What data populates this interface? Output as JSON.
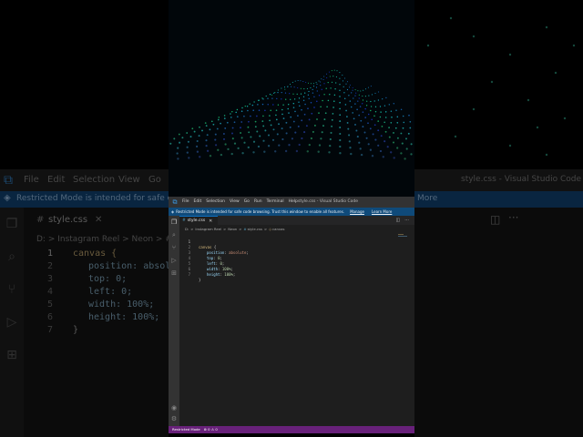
{
  "window": {
    "title": "style.css - Visual Studio Code",
    "menu": [
      "File",
      "Edit",
      "Selection",
      "View",
      "Go",
      "Run",
      "Terminal",
      "Help"
    ]
  },
  "banner": {
    "message": "Restricted Mode is intended for safe code browsing. Trust this window to enable all features.",
    "manage_link": "Manage",
    "learn_more_link": "Learn More"
  },
  "tab": {
    "icon": "#",
    "filename": "style.css",
    "close": "✕"
  },
  "breadcrumb": {
    "items": [
      "D:",
      "Instagram Reel",
      "Neon",
      "style.css",
      "canvas"
    ],
    "separator": ">"
  },
  "code": {
    "lines": [
      {
        "n": "1",
        "selector": "canvas",
        "open": " {"
      },
      {
        "n": "2",
        "prop": "position",
        "value": "absolute",
        "kind": "val"
      },
      {
        "n": "3",
        "prop": "top",
        "value": "0",
        "kind": "num"
      },
      {
        "n": "4",
        "prop": "left",
        "value": "0",
        "kind": "num"
      },
      {
        "n": "5",
        "prop": "width",
        "value": "100%",
        "kind": "num"
      },
      {
        "n": "6",
        "prop": "height",
        "value": "100%",
        "kind": "num"
      },
      {
        "n": "7",
        "close": "}"
      }
    ]
  },
  "statusbar": {
    "restricted_mode": "Restricted Mode",
    "problems": "⊗ 0 ⚠ 0"
  },
  "background": {
    "title": "style.css - Visual Studio Code",
    "menu": [
      "File",
      "Edit",
      "Selection",
      "View",
      "Go"
    ],
    "banner": "Restricted Mode is intended for safe code",
    "learn_more": "More",
    "tab": "style.css",
    "crumbs": "D: > Instagram Reel > Neon > #",
    "lines": [
      "canvas {",
      "position: absolu",
      "top: 0;",
      "left: 0;",
      "width: 100%;",
      "height: 100%;",
      "}"
    ],
    "line_numbers": [
      "1",
      "2",
      "3",
      "4",
      "5",
      "6",
      "7"
    ]
  },
  "colors": {
    "accent": "#0e70c0",
    "statusbar": "#68217a",
    "banner": "#0f4a7a",
    "editor_bg": "#1e1e1e"
  }
}
